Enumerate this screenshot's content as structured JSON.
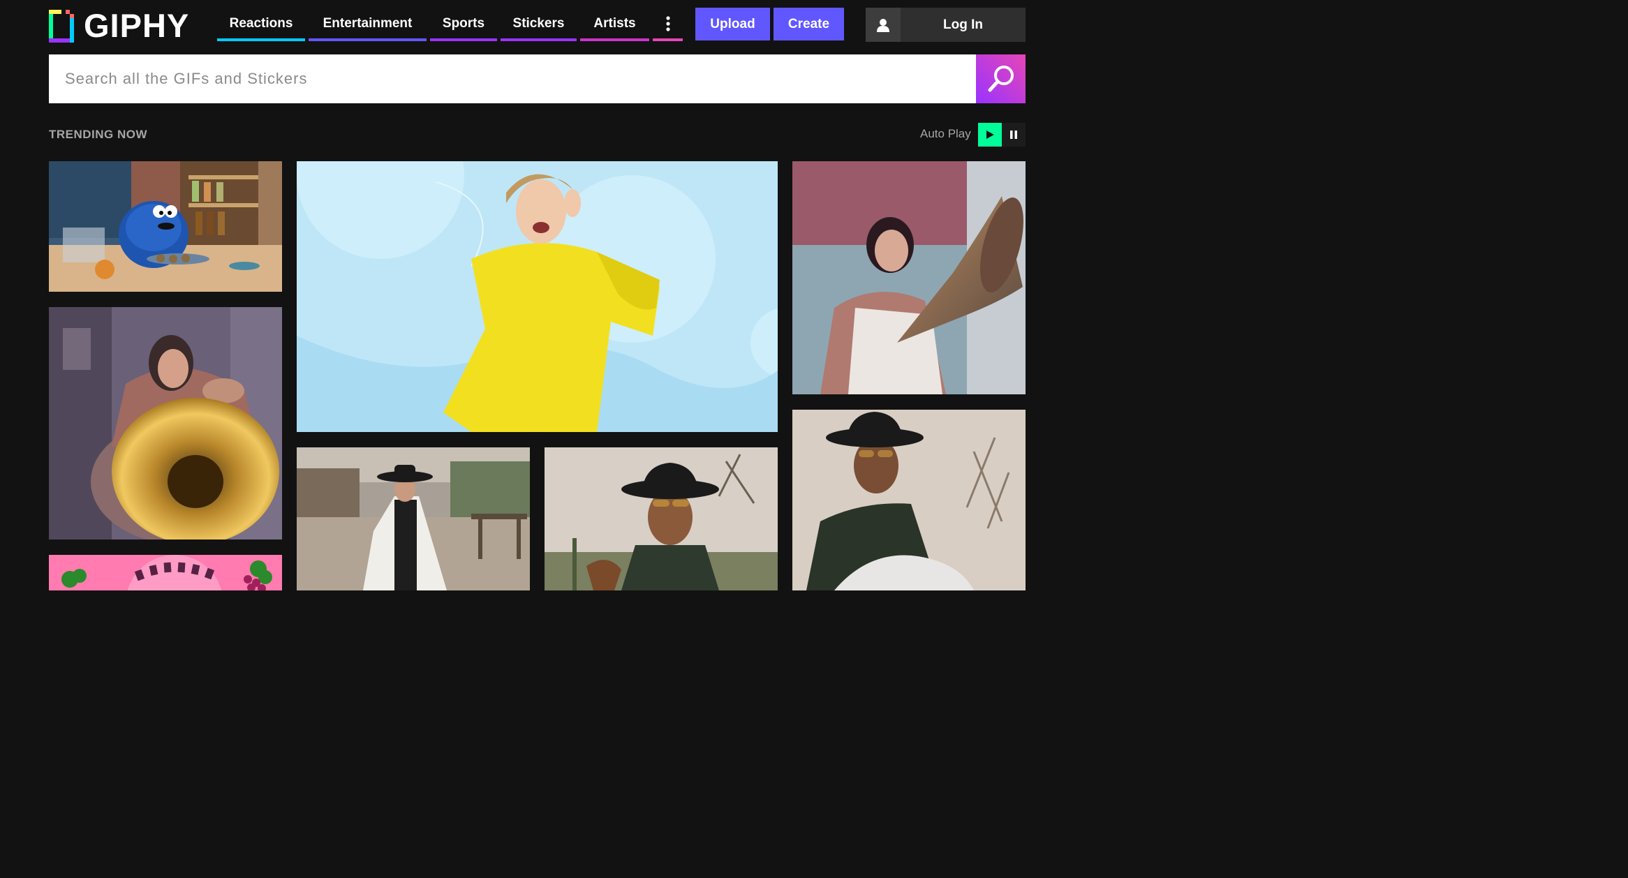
{
  "brand": {
    "name": "GIPHY"
  },
  "nav": {
    "items": [
      {
        "label": "Reactions",
        "color": "#00ccff"
      },
      {
        "label": "Entertainment",
        "color": "#6157ff"
      },
      {
        "label": "Sports",
        "color": "#9933ff"
      },
      {
        "label": "Stickers",
        "color": "#9933ff"
      },
      {
        "label": "Artists",
        "color": "#cc33cc"
      }
    ],
    "more_icon": "vertical-dots-icon",
    "more_color": "#e646b6"
  },
  "actions": {
    "upload": "Upload",
    "create": "Create",
    "login": "Log In"
  },
  "search": {
    "placeholder": "Search all the GIFs and Stickers",
    "icon": "search-icon"
  },
  "trending": {
    "title": "TRENDING NOW",
    "autoplay_label": "Auto Play",
    "play_icon": "play-icon",
    "pause_icon": "pause-icon"
  },
  "colors": {
    "accent": "#6157ff",
    "play": "#00ff99",
    "background": "#121212"
  }
}
